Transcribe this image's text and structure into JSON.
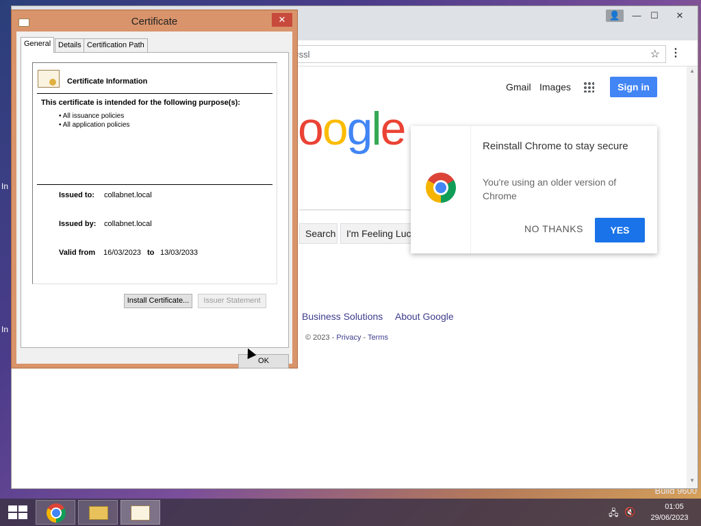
{
  "desktop": {
    "build_text": "Build 9600",
    "edge_text_1": "In",
    "edge_text_2": "In"
  },
  "chrome": {
    "omnibox_text": "=ssl",
    "controls": {
      "min": "—",
      "max": "☐",
      "close": "✕"
    },
    "google": {
      "gmail": "Gmail",
      "images": "Images",
      "signin": "Sign in",
      "logo_letters": [
        {
          "ch": "o",
          "color": "#ea4335"
        },
        {
          "ch": "o",
          "color": "#fbbc05"
        },
        {
          "ch": "g",
          "color": "#4285f4"
        },
        {
          "ch": "l",
          "color": "#34a853"
        },
        {
          "ch": "e",
          "color": "#ea4335"
        }
      ],
      "search_btn": "Search",
      "lucky_btn": "I'm Feeling Lucky",
      "business": "Business Solutions",
      "about": "About Google",
      "footer_copy": "© 2023 - ",
      "footer_privacy": "Privacy",
      "footer_sep": " - ",
      "footer_terms": "Terms"
    },
    "popup": {
      "title": "Reinstall Chrome to stay secure",
      "message": "You're using an older version of Chrome",
      "no_thanks": "NO THANKS",
      "yes": "YES"
    }
  },
  "certificate": {
    "window_title": "Certificate",
    "close": "✕",
    "tabs": [
      "General",
      "Details",
      "Certification Path"
    ],
    "info_title": "Certificate Information",
    "purpose_heading": "This certificate is intended for the following purpose(s):",
    "purposes": [
      "• All issuance policies",
      "• All application policies"
    ],
    "issued_to_label": "Issued to:",
    "issued_to": "collabnet.local",
    "issued_by_label": "Issued by:",
    "issued_by": "collabnet.local",
    "valid_from_label": "Valid from",
    "valid_from": "16/03/2023",
    "to_label": "to",
    "valid_to": "13/03/2033",
    "install_btn": "Install Certificate...",
    "issuer_btn": "Issuer Statement",
    "ok_btn": "OK"
  },
  "taskbar": {
    "time": "01:05",
    "date": "29/06/2023"
  }
}
